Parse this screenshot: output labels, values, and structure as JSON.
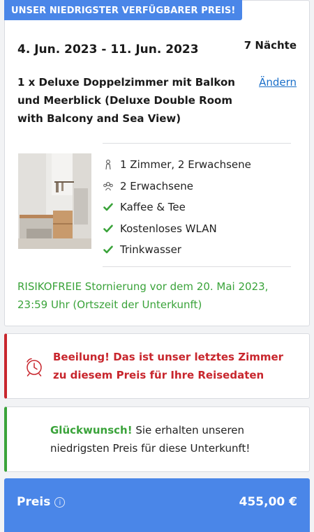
{
  "offer": {
    "ribbon": "UNSER NIEDRIGSTER VERFÜGBARER PREIS!",
    "dates": "4. Jun. 2023 - 11. Jun. 2023",
    "nights": "7 Nächte",
    "room_name": "1 x Deluxe Doppelzimmer mit Balkon und Meerblick (Deluxe Double Room with Balcony and Sea View)",
    "change_link": "Ändern",
    "features": [
      {
        "icon": "person-icon",
        "label": "1 Zimmer, 2 Erwachsene"
      },
      {
        "icon": "group-icon",
        "label": "2 Erwachsene"
      },
      {
        "icon": "check-icon",
        "label": "Kaffee & Tee"
      },
      {
        "icon": "check-icon",
        "label": "Kostenloses WLAN"
      },
      {
        "icon": "check-icon",
        "label": "Trinkwasser"
      }
    ],
    "cancellation": "RISIKOFREIE Stornierung vor dem 20. Mai 2023, 23:59 Uhr (Ortszeit der Unterkunft)"
  },
  "alert": {
    "icon": "alarm-clock-icon",
    "text": "Beeilung! Das ist unser letztes Zimmer zu diesem Preis für Ihre Reisedaten"
  },
  "congrats": {
    "highlight": "Glückwunsch!",
    "text": " Sie erhalten unseren niedrigsten Preis für diese Unterkunft!"
  },
  "price": {
    "label": "Preis",
    "info_icon": "info-icon",
    "value": "455,00 €"
  },
  "colors": {
    "accent_blue": "#4a86e8",
    "success_green": "#3aa33a",
    "alert_red": "#c8262d",
    "link_blue": "#1a6fc9"
  }
}
